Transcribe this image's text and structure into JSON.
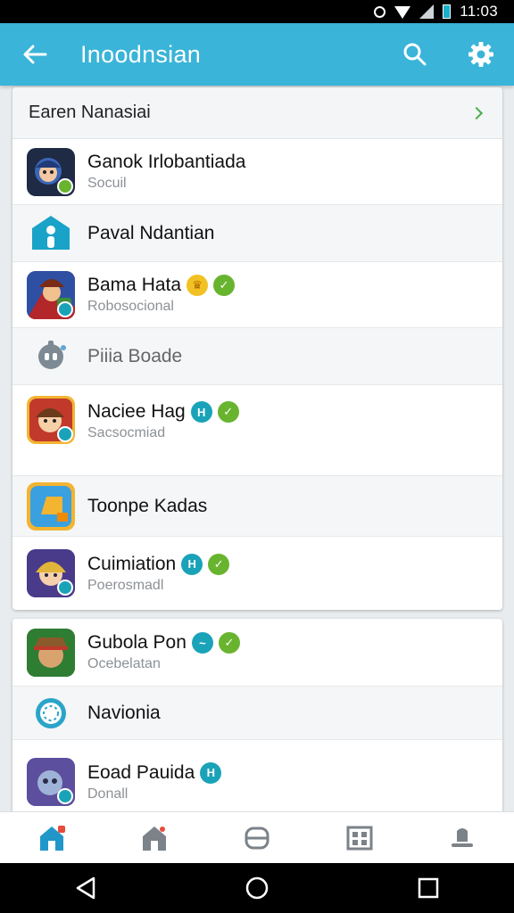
{
  "status_bar": {
    "time": "11:03"
  },
  "app_bar": {
    "title": "Inoodnsian"
  },
  "card1": {
    "header": "Earen Nanasiai",
    "rows": [
      {
        "title": "Ganok Irlobantiada",
        "subtitle": "Socuil"
      },
      {
        "title": "Paval Ndantian",
        "subtitle": ""
      },
      {
        "title": "Bama Hata",
        "subtitle": "Robosocional"
      },
      {
        "title": "Piiia Boade",
        "subtitle": ""
      },
      {
        "title": "Naciee Hag",
        "subtitle": "Sacsocmiad"
      },
      {
        "title": "Toonpe Kadas",
        "subtitle": ""
      },
      {
        "title": "Cuimiation",
        "subtitle": "Poerosmadl"
      }
    ]
  },
  "card2": {
    "rows": [
      {
        "title": "Gubola Pon",
        "subtitle": "Ocebelatan"
      },
      {
        "title": "Navionia",
        "subtitle": ""
      },
      {
        "title": "Eoad Pauida",
        "subtitle": "Donall"
      }
    ]
  },
  "icons": {
    "back": "arrow-left-icon",
    "search": "search-icon",
    "settings": "gear-icon"
  },
  "colors": {
    "app_bar": "#3ab4d8",
    "accent_teal": "#1aa3b8",
    "accent_green": "#69b42f",
    "nav_active": "#2196c9"
  }
}
